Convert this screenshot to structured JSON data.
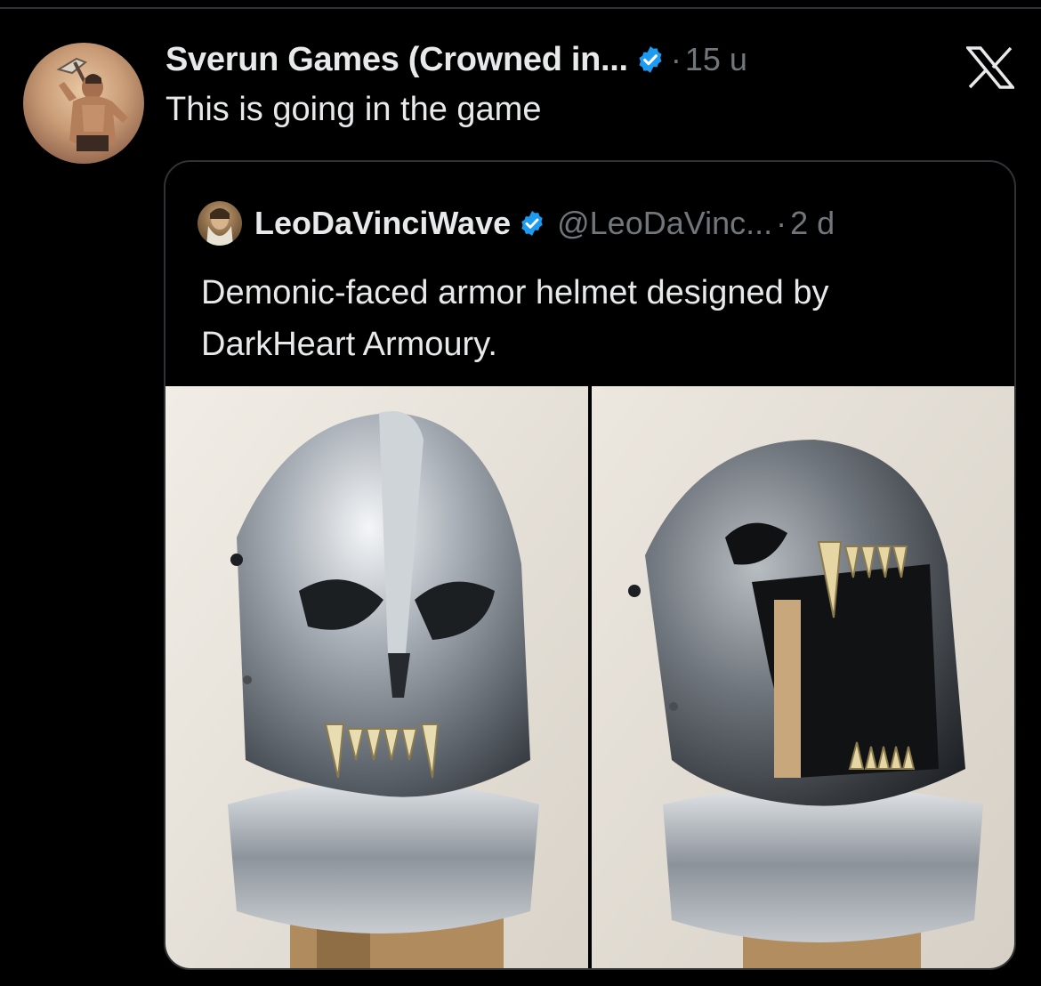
{
  "tweet": {
    "author_name": "Sverun Games (Crowned in...",
    "separator": "·",
    "time": "15 u",
    "text": "This is going in the game",
    "avatar_icon": "warrior-avatar",
    "verified_icon": "verified-badge-icon",
    "verified_color": "#1d9bf0"
  },
  "quote": {
    "author_name": "LeoDaVinciWave",
    "handle": "@LeoDaVinc...",
    "separator": "·",
    "time": "2 d",
    "text_line1": "Demonic-faced armor helmet designed by",
    "text_line2": "DarkHeart Armoury.",
    "media": [
      {
        "name": "helmet-front-photo"
      },
      {
        "name": "helmet-side-photo"
      }
    ]
  },
  "app": {
    "close_icon": "x-logo-icon"
  }
}
